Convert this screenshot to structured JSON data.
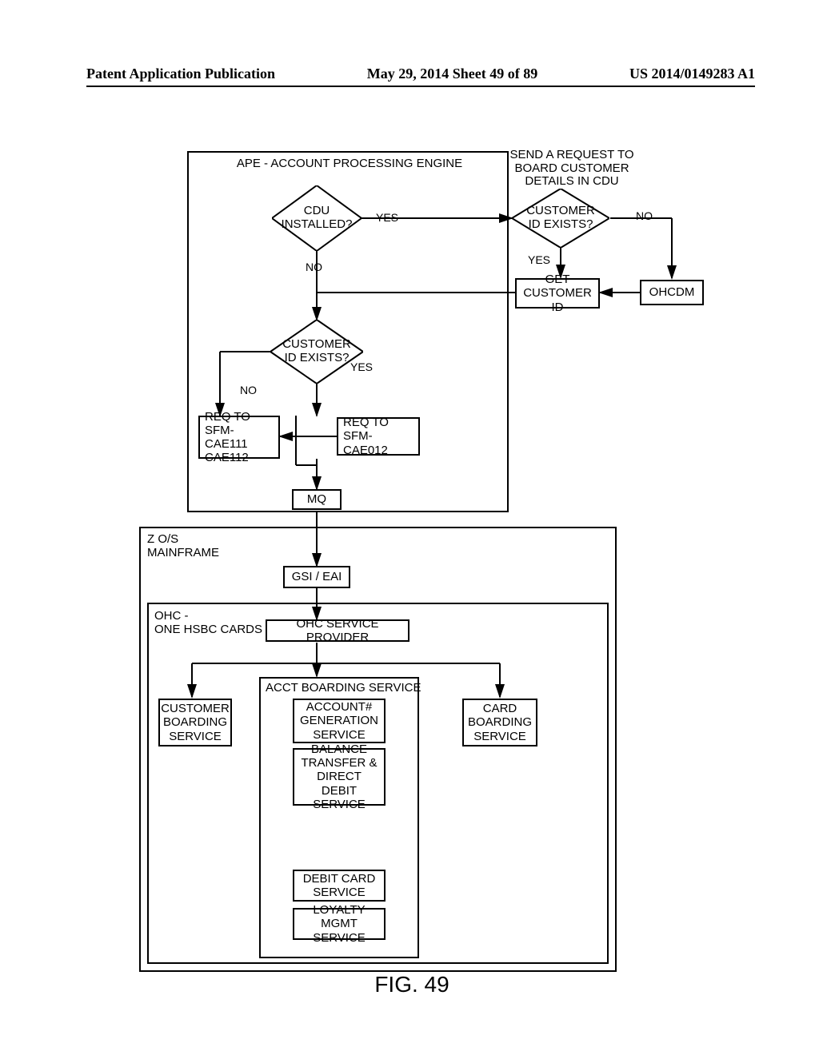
{
  "header": {
    "left": "Patent Application Publication",
    "center": "May 29, 2014  Sheet 49 of 89",
    "right": "US 2014/0149283 A1"
  },
  "ape": {
    "title": "APE - ACCOUNT PROCESSING ENGINE",
    "cdu_installed": "CDU\nINSTALLED?",
    "yes1": "YES",
    "no1": "NO",
    "send_request": "SEND A REQUEST TO\nBOARD CUSTOMER\nDETAILS IN CDU",
    "customer_id_exists_top": "CUSTOMER\nID EXISTS?",
    "yes2": "YES",
    "no2": "NO",
    "get_customer_id": "GET CUSTOMER\nID",
    "ohcdm": "OHCDM",
    "customer_id_exists_bot": "CUSTOMER\nID EXISTS?",
    "yes3": "YES",
    "no3": "NO",
    "req_111_112": "REQ TO SFM-\nCAE111\nCAE112",
    "req_012": "REQ TO SFM-\nCAE012",
    "mq": "MQ"
  },
  "mainframe": {
    "title": "Z O/S\nMAINFRAME",
    "gsi": "GSI / EAI"
  },
  "ohc": {
    "title": "OHC -\nONE HSBC CARDS",
    "provider": "OHC SERVICE PROVIDER",
    "cust_boarding": "CUSTOMER\nBOARDING\nSERVICE",
    "acct_boarding": "ACCT BOARDING SERVICE",
    "acct_gen": "ACCOUNT#\nGENERATION\nSERVICE",
    "bal_transfer": "BALANCE\nTRANSFER &\nDIRECT DEBIT\nSERVICE",
    "debit_card": "DEBIT CARD\nSERVICE",
    "loyalty": "LOYALTY\nMGMT SERVICE",
    "card_boarding": "CARD\nBOARDING\nSERVICE"
  },
  "figure": "FIG. 49"
}
